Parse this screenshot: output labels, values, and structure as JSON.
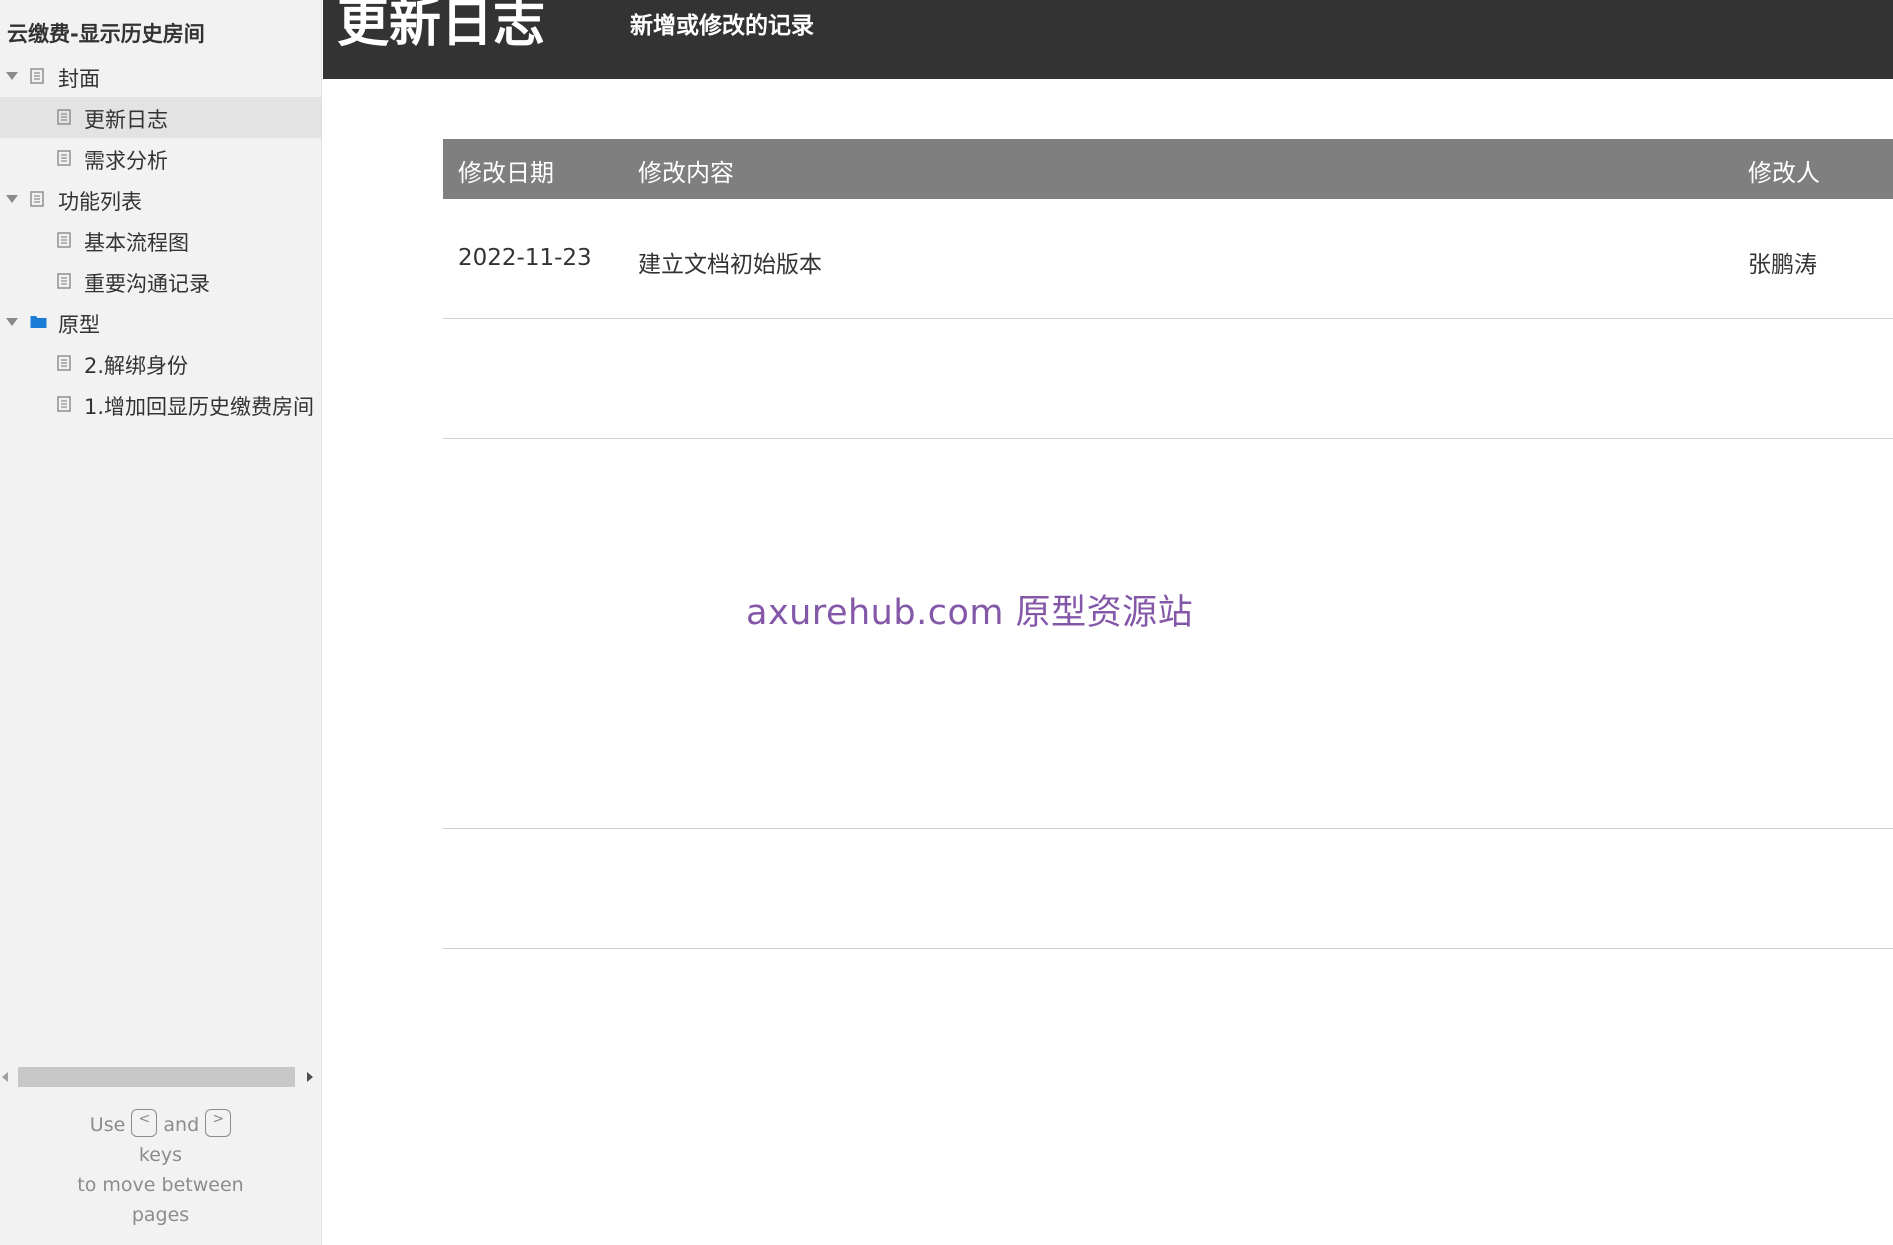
{
  "sidebar": {
    "project_title": "云缴费-显示历史房间",
    "items": [
      {
        "label": "封面"
      },
      {
        "label": "更新日志"
      },
      {
        "label": "需求分析"
      },
      {
        "label": "功能列表"
      },
      {
        "label": "基本流程图"
      },
      {
        "label": "重要沟通记录"
      },
      {
        "label": "原型"
      },
      {
        "label": "2.解绑身份"
      },
      {
        "label": "1.增加回显历史缴费房间"
      }
    ],
    "help": {
      "use": "Use",
      "key_prev": "<",
      "and": "and",
      "key_next": ">",
      "keys": "keys",
      "to_move": "to move between",
      "pages": "pages"
    }
  },
  "header": {
    "title": "更新日志",
    "subtitle": "新增或修改的记录"
  },
  "table": {
    "columns": [
      "修改日期",
      "修改内容",
      "修改人"
    ],
    "rows": [
      {
        "date": "2022-11-23",
        "content": "建立文档初始版本",
        "author": "张鹏涛"
      }
    ]
  },
  "watermark": "axurehub.com 原型资源站",
  "colors": {
    "header_bg": "#333333",
    "table_header_bg": "#7f7f7f",
    "sidebar_bg": "#f2f2f2",
    "folder_icon": "#1a7ed6",
    "watermark": "#8458a8"
  }
}
